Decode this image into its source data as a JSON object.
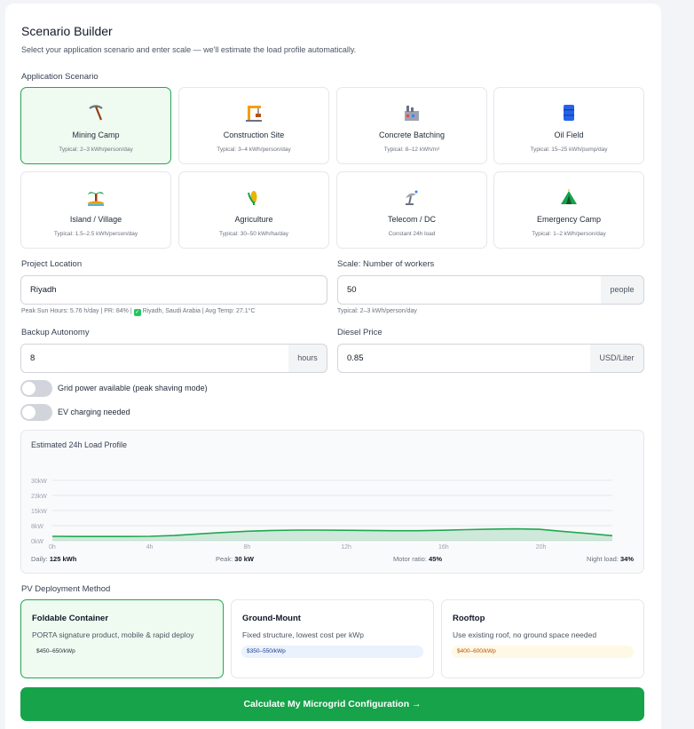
{
  "page": {
    "title": "Scenario Builder",
    "subtitle": "Select your application scenario and enter scale — we'll estimate the load profile automatically."
  },
  "scenario": {
    "label": "Application Scenario",
    "items": [
      {
        "name": "Mining Camp",
        "typical": "Typical: 2–3 kWh/person/day",
        "icon": "pickaxe-icon",
        "selected": true
      },
      {
        "name": "Construction Site",
        "typical": "Typical: 3–4 kWh/person/day",
        "icon": "crane-icon",
        "selected": false
      },
      {
        "name": "Concrete Batching",
        "typical": "Typical: 8–12 kWh/m³",
        "icon": "factory-icon",
        "selected": false
      },
      {
        "name": "Oil Field",
        "typical": "Typical: 15–25 kWh/pump/day",
        "icon": "oil-barrel-icon",
        "selected": false
      },
      {
        "name": "Island / Village",
        "typical": "Typical: 1.5–2.5 kWh/person/day",
        "icon": "palm-island-icon",
        "selected": false
      },
      {
        "name": "Agriculture",
        "typical": "Typical: 30–50 kWh/ha/day",
        "icon": "crop-icon",
        "selected": false
      },
      {
        "name": "Telecom / DC",
        "typical": "Constant 24h load",
        "icon": "satellite-dish-icon",
        "selected": false
      },
      {
        "name": "Emergency Camp",
        "typical": "Typical: 1–2 kWh/person/day",
        "icon": "tent-icon",
        "selected": false
      }
    ]
  },
  "location": {
    "label": "Project Location",
    "value": "Riyadh",
    "hint_prefix": "Peak Sun Hours: 5.76 h/day | PR: 84% |",
    "hint_suffix": "Riyadh, Saudi Arabia | Avg Temp: 27.1°C"
  },
  "scale": {
    "label": "Scale: Number of workers",
    "value": "50",
    "unit": "people",
    "hint": "Typical: 2–3 kWh/person/day"
  },
  "autonomy": {
    "label": "Backup Autonomy",
    "value": "8",
    "unit": "hours"
  },
  "diesel": {
    "label": "Diesel Price",
    "value": "0.85",
    "unit": "USD/Liter"
  },
  "toggles": {
    "grid": {
      "label": "Grid power available (peak shaving mode)",
      "on": false
    },
    "ev": {
      "label": "EV charging needed",
      "on": false
    }
  },
  "chart_data": {
    "type": "area",
    "title": "Estimated 24h Load Profile",
    "y_ticks": [
      "30kW",
      "23kW",
      "15kW",
      "8kW",
      "0kW"
    ],
    "x_ticks": [
      "0h",
      "4h",
      "8h",
      "12h",
      "16h",
      "20h"
    ],
    "ylim": [
      0,
      30
    ],
    "xlim": [
      0,
      23
    ],
    "x": [
      0,
      1,
      2,
      3,
      4,
      5,
      6,
      7,
      8,
      9,
      10,
      11,
      12,
      13,
      14,
      15,
      16,
      17,
      18,
      19,
      20,
      21,
      22,
      23
    ],
    "values": [
      2.2,
      2.1,
      2.1,
      2.1,
      2.2,
      2.6,
      3.4,
      4.1,
      4.7,
      5.1,
      5.3,
      5.3,
      5.2,
      5.1,
      5.0,
      5.0,
      5.2,
      5.5,
      5.8,
      5.9,
      5.7,
      4.6,
      3.6,
      2.5
    ],
    "color": "#22a653",
    "grid": true,
    "stats": {
      "daily_label": "Daily:",
      "daily_value": "125 kWh",
      "peak_label": "Peak:",
      "peak_value": "30 kW",
      "motor_label": "Motor ratio:",
      "motor_value": "45%",
      "night_label": "Night load:",
      "night_value": "34%"
    }
  },
  "pv": {
    "label": "PV Deployment Method",
    "options": [
      {
        "name": "Foldable Container",
        "desc": "PORTA signature product, mobile & rapid deploy",
        "price": "$450–650/kWp",
        "badge_bg": "#effbf1",
        "badge_fg": "#1f2937",
        "selected": true
      },
      {
        "name": "Ground-Mount",
        "desc": "Fixed structure, lowest cost per kWp",
        "price": "$350–550/kWp",
        "badge_bg": "#eaf2fd",
        "badge_fg": "#1e3a8a",
        "selected": false
      },
      {
        "name": "Rooftop",
        "desc": "Use existing roof, no ground space needed",
        "price": "$400–600/kWp",
        "badge_bg": "#fef8e6",
        "badge_fg": "#b45309",
        "selected": false
      }
    ]
  },
  "cta": {
    "label": "Calculate My Microgrid Configuration →"
  },
  "colors": {
    "accent": "#16a34a",
    "accent_light": "#effbf1"
  }
}
